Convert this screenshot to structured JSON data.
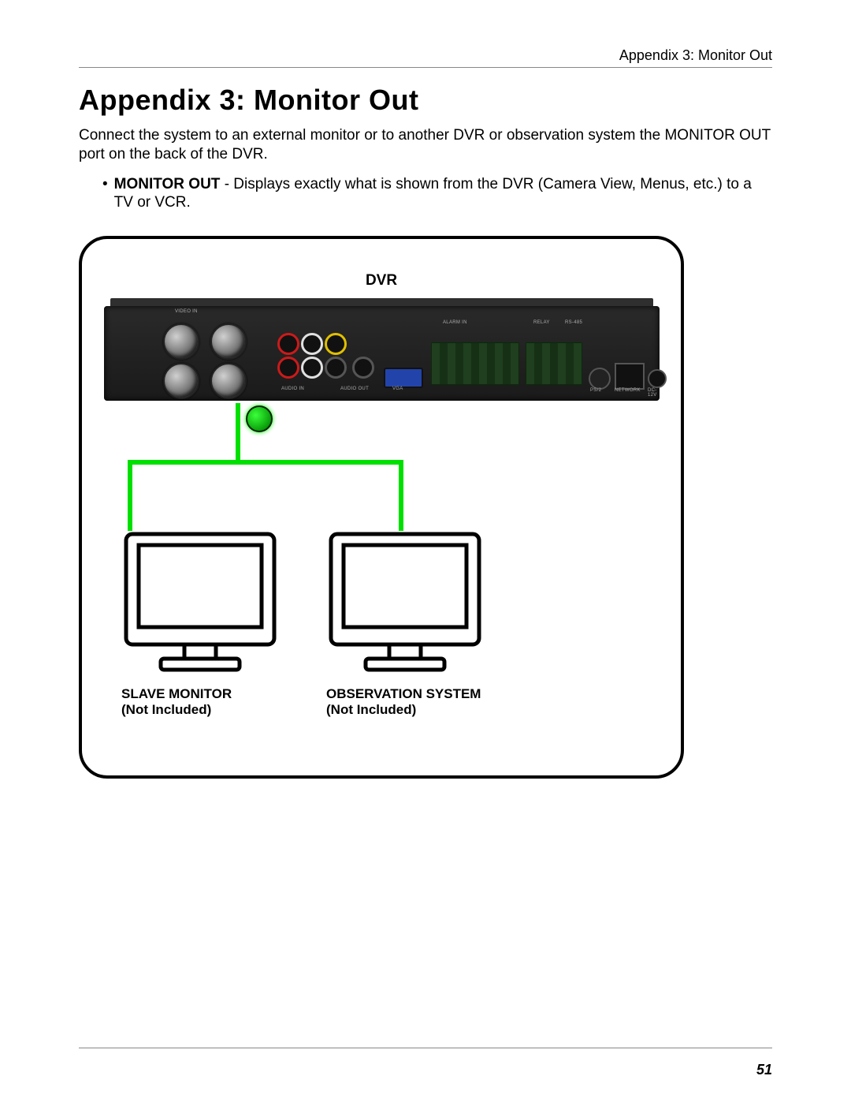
{
  "header": {
    "running": "Appendix 3: Monitor Out"
  },
  "title": "Appendix 3: Monitor Out",
  "intro": "Connect the system to an external monitor or to another DVR or observation system the MONITOR OUT port on the back of the DVR.",
  "bullet": {
    "lead": "MONITOR OUT",
    "rest": " - Displays exactly what is shown from the DVR (Camera View, Menus, etc.) to a TV or VCR."
  },
  "figure": {
    "dvr_label": "DVR",
    "port_captions": {
      "video_in": "VIDEO IN",
      "audio_in": "AUDIO IN",
      "audio_out": "AUDIO OUT",
      "vga": "VGA",
      "alarm_in": "ALARM IN",
      "relay": "RELAY",
      "rs485": "RS-485",
      "ps2": "PS/2",
      "network": "NETWORK",
      "dc": "DC-12V"
    },
    "left_monitor": {
      "line1": "SLAVE MONITOR",
      "line2": "(Not Included)"
    },
    "right_monitor": {
      "line1": "OBSERVATION SYSTEM",
      "line2": "(Not Included)"
    }
  },
  "page_number": "51"
}
